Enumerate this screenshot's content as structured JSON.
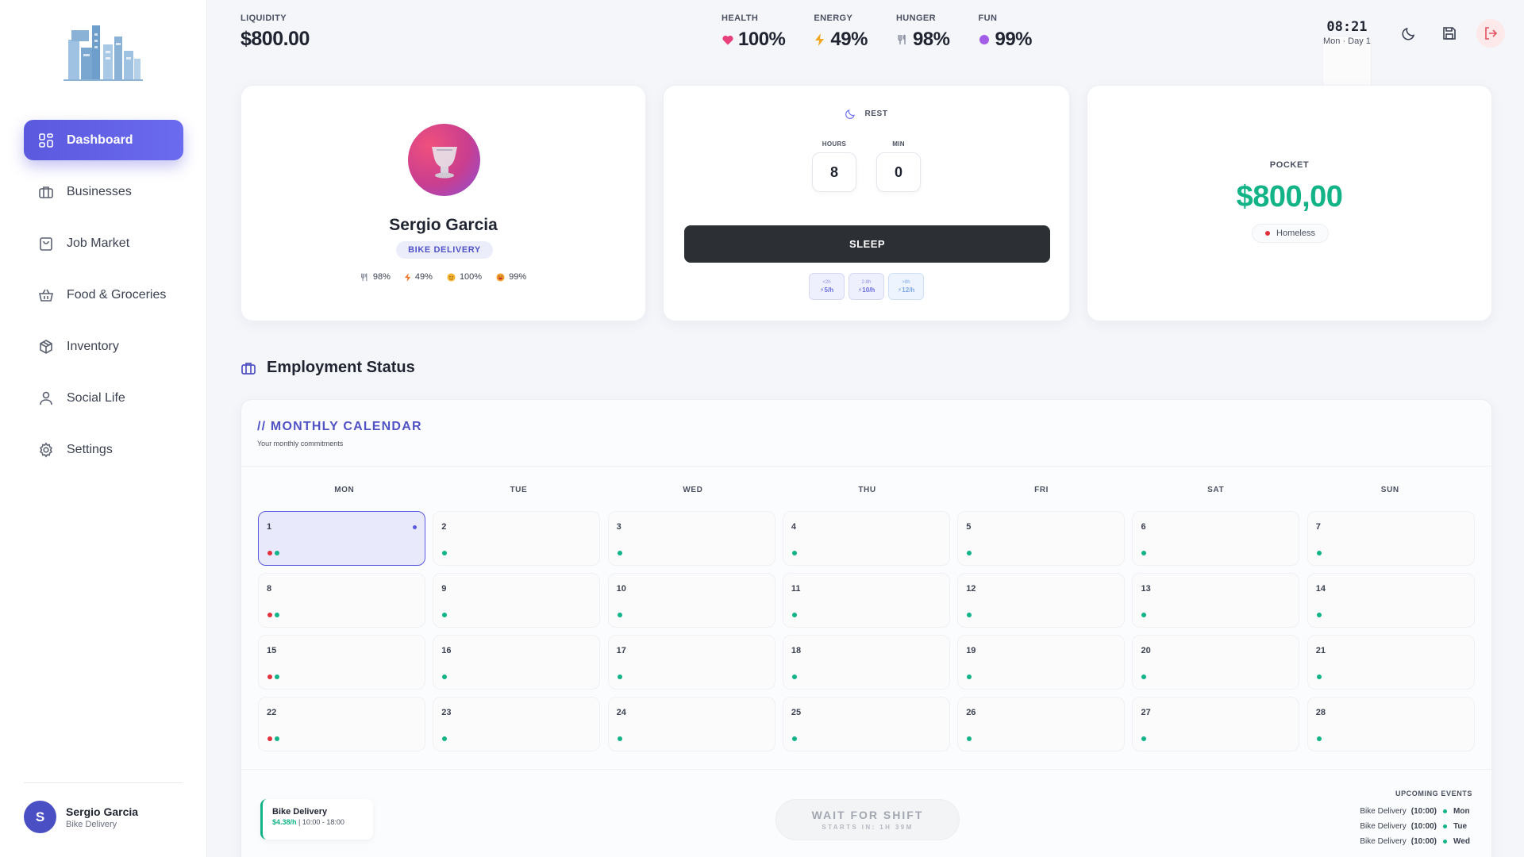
{
  "sidebar": {
    "items": [
      {
        "label": "Dashboard",
        "icon": "dashboard-icon",
        "active": true
      },
      {
        "label": "Businesses",
        "icon": "briefcase-icon"
      },
      {
        "label": "Job Market",
        "icon": "shopping-bag-icon"
      },
      {
        "label": "Food & Groceries",
        "icon": "basket-icon"
      },
      {
        "label": "Inventory",
        "icon": "box-icon"
      },
      {
        "label": "Social Life",
        "icon": "user-icon"
      },
      {
        "label": "Settings",
        "icon": "gear-icon"
      }
    ],
    "user": {
      "initial": "S",
      "name": "Sergio Garcia",
      "role": "Bike Delivery"
    }
  },
  "topbar": {
    "liquidity": {
      "label": "LIQUIDITY",
      "value": "$800.00"
    },
    "vitals": [
      {
        "label": "HEALTH",
        "value": "100%",
        "icon": "heart-icon",
        "color": "#e8407a"
      },
      {
        "label": "ENERGY",
        "value": "49%",
        "icon": "lightning-icon",
        "color": "#f2a51e"
      },
      {
        "label": "HUNGER",
        "value": "98%",
        "icon": "fork-knife-icon",
        "color": "#8b90a0"
      },
      {
        "label": "FUN",
        "value": "99%",
        "icon": "purple-dot-icon",
        "color": "#a35ee8"
      }
    ],
    "clock": {
      "time": "08:21",
      "day": "Mon · Day 1"
    }
  },
  "profile": {
    "name": "Sergio Garcia",
    "badge": "BIKE DELIVERY",
    "stats": [
      {
        "icon": "fork-knife-icon",
        "value": "98%"
      },
      {
        "icon": "lightning-icon",
        "value": "49%"
      },
      {
        "icon": "smile-icon",
        "value": "100%"
      },
      {
        "icon": "happy-face-icon",
        "value": "99%"
      }
    ]
  },
  "rest": {
    "title": "REST",
    "hours_label": "HOURS",
    "hours_value": "8",
    "min_label": "MIN",
    "min_value": "0",
    "button": "SLEEP",
    "rates": [
      {
        "top": "<2h",
        "value": "⚡5/h"
      },
      {
        "top": "2-8h",
        "value": "⚡10/h"
      },
      {
        "top": ">8h",
        "value": "⚡12/h"
      }
    ]
  },
  "pocket": {
    "label": "POCKET",
    "value": "$800,00",
    "status": "Homeless",
    "status_color": "#e2303d"
  },
  "employment": {
    "title": "Employment Status",
    "calendar": {
      "title": "// MONTHLY CALENDAR",
      "subtitle": "Your monthly commitments",
      "weekdays": [
        "MON",
        "TUE",
        "WED",
        "THU",
        "FRI",
        "SAT",
        "SUN"
      ],
      "days": [
        {
          "n": "1",
          "today": true,
          "red": true
        },
        {
          "n": "2"
        },
        {
          "n": "3"
        },
        {
          "n": "4"
        },
        {
          "n": "5"
        },
        {
          "n": "6"
        },
        {
          "n": "7"
        },
        {
          "n": "8",
          "red": true
        },
        {
          "n": "9"
        },
        {
          "n": "10"
        },
        {
          "n": "11"
        },
        {
          "n": "12"
        },
        {
          "n": "13"
        },
        {
          "n": "14"
        },
        {
          "n": "15",
          "red": true
        },
        {
          "n": "16"
        },
        {
          "n": "17"
        },
        {
          "n": "18"
        },
        {
          "n": "19"
        },
        {
          "n": "20"
        },
        {
          "n": "21"
        },
        {
          "n": "22",
          "red": true
        },
        {
          "n": "23"
        },
        {
          "n": "24"
        },
        {
          "n": "25"
        },
        {
          "n": "26"
        },
        {
          "n": "27"
        },
        {
          "n": "28"
        }
      ]
    },
    "shift": {
      "title": "Bike Delivery",
      "rate": "$4.38/h",
      "hours": " | 10:00 - 18:00"
    },
    "wait": {
      "title": "WAIT FOR SHIFT",
      "subtitle": "STARTS IN: 1H 39M"
    },
    "upcoming": {
      "title": "UPCOMING EVENTS",
      "events": [
        {
          "name": "Bike Delivery",
          "time": "(10:00)",
          "day": "Mon"
        },
        {
          "name": "Bike Delivery",
          "time": "(10:00)",
          "day": "Tue"
        },
        {
          "name": "Bike Delivery",
          "time": "(10:00)",
          "day": "Wed"
        }
      ]
    }
  }
}
